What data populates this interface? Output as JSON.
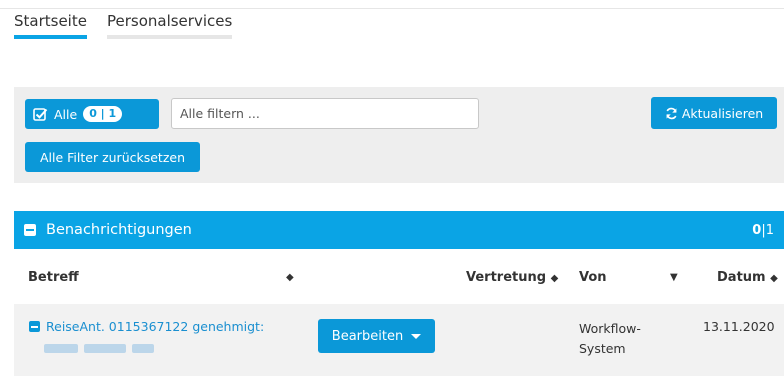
{
  "tabs": [
    {
      "label": "Startseite",
      "active": true
    },
    {
      "label": "Personalservices",
      "active": false
    }
  ],
  "filter": {
    "alle_label": "Alle",
    "alle_badge": "0 | 1",
    "search_placeholder": "Alle filtern ...",
    "refresh_label": "Aktualisieren",
    "reset_label": "Alle Filter zurücksetzen"
  },
  "panel": {
    "title": "Benachrichtigungen",
    "count_selected": "0",
    "count_total": "|1"
  },
  "table": {
    "columns": {
      "betreff": "Betreff",
      "vertretung": "Vertretung",
      "von": "Von",
      "datum": "Datum"
    },
    "rows": [
      {
        "subject": "ReiseAnt. 0115367122 genehmigt:",
        "action_label": "Bearbeiten",
        "von_line1": "Workflow-",
        "von_line2": "System",
        "datum": "13.11.2020"
      }
    ]
  },
  "colors": {
    "accent": "#0aa4e5",
    "button": "#0b98d8",
    "link": "#1a8fd0",
    "filterbar_bg": "#eeeeee",
    "row_bg": "#f2f2f2"
  },
  "icons": {
    "alle": "checkbox-checked-icon",
    "refresh": "refresh-icon",
    "collapse": "minus-square-icon",
    "sort": "sort-icon",
    "dropdown": "caret-down-icon"
  }
}
